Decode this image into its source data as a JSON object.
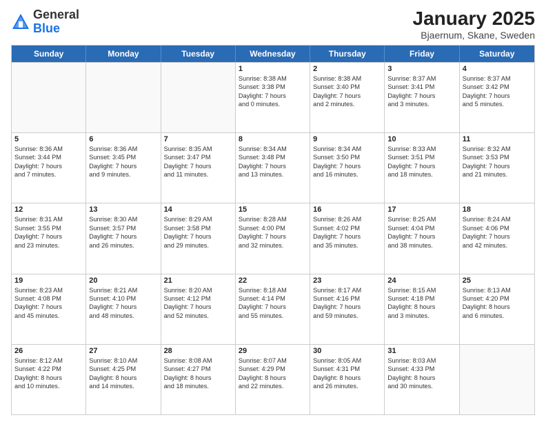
{
  "logo": {
    "general": "General",
    "blue": "Blue"
  },
  "header": {
    "title": "January 2025",
    "subtitle": "Bjaernum, Skane, Sweden"
  },
  "days": [
    "Sunday",
    "Monday",
    "Tuesday",
    "Wednesday",
    "Thursday",
    "Friday",
    "Saturday"
  ],
  "weeks": [
    [
      {
        "day": "",
        "lines": []
      },
      {
        "day": "",
        "lines": []
      },
      {
        "day": "",
        "lines": []
      },
      {
        "day": "1",
        "lines": [
          "Sunrise: 8:38 AM",
          "Sunset: 3:38 PM",
          "Daylight: 7 hours",
          "and 0 minutes."
        ]
      },
      {
        "day": "2",
        "lines": [
          "Sunrise: 8:38 AM",
          "Sunset: 3:40 PM",
          "Daylight: 7 hours",
          "and 2 minutes."
        ]
      },
      {
        "day": "3",
        "lines": [
          "Sunrise: 8:37 AM",
          "Sunset: 3:41 PM",
          "Daylight: 7 hours",
          "and 3 minutes."
        ]
      },
      {
        "day": "4",
        "lines": [
          "Sunrise: 8:37 AM",
          "Sunset: 3:42 PM",
          "Daylight: 7 hours",
          "and 5 minutes."
        ]
      }
    ],
    [
      {
        "day": "5",
        "lines": [
          "Sunrise: 8:36 AM",
          "Sunset: 3:44 PM",
          "Daylight: 7 hours",
          "and 7 minutes."
        ]
      },
      {
        "day": "6",
        "lines": [
          "Sunrise: 8:36 AM",
          "Sunset: 3:45 PM",
          "Daylight: 7 hours",
          "and 9 minutes."
        ]
      },
      {
        "day": "7",
        "lines": [
          "Sunrise: 8:35 AM",
          "Sunset: 3:47 PM",
          "Daylight: 7 hours",
          "and 11 minutes."
        ]
      },
      {
        "day": "8",
        "lines": [
          "Sunrise: 8:34 AM",
          "Sunset: 3:48 PM",
          "Daylight: 7 hours",
          "and 13 minutes."
        ]
      },
      {
        "day": "9",
        "lines": [
          "Sunrise: 8:34 AM",
          "Sunset: 3:50 PM",
          "Daylight: 7 hours",
          "and 16 minutes."
        ]
      },
      {
        "day": "10",
        "lines": [
          "Sunrise: 8:33 AM",
          "Sunset: 3:51 PM",
          "Daylight: 7 hours",
          "and 18 minutes."
        ]
      },
      {
        "day": "11",
        "lines": [
          "Sunrise: 8:32 AM",
          "Sunset: 3:53 PM",
          "Daylight: 7 hours",
          "and 21 minutes."
        ]
      }
    ],
    [
      {
        "day": "12",
        "lines": [
          "Sunrise: 8:31 AM",
          "Sunset: 3:55 PM",
          "Daylight: 7 hours",
          "and 23 minutes."
        ]
      },
      {
        "day": "13",
        "lines": [
          "Sunrise: 8:30 AM",
          "Sunset: 3:57 PM",
          "Daylight: 7 hours",
          "and 26 minutes."
        ]
      },
      {
        "day": "14",
        "lines": [
          "Sunrise: 8:29 AM",
          "Sunset: 3:58 PM",
          "Daylight: 7 hours",
          "and 29 minutes."
        ]
      },
      {
        "day": "15",
        "lines": [
          "Sunrise: 8:28 AM",
          "Sunset: 4:00 PM",
          "Daylight: 7 hours",
          "and 32 minutes."
        ]
      },
      {
        "day": "16",
        "lines": [
          "Sunrise: 8:26 AM",
          "Sunset: 4:02 PM",
          "Daylight: 7 hours",
          "and 35 minutes."
        ]
      },
      {
        "day": "17",
        "lines": [
          "Sunrise: 8:25 AM",
          "Sunset: 4:04 PM",
          "Daylight: 7 hours",
          "and 38 minutes."
        ]
      },
      {
        "day": "18",
        "lines": [
          "Sunrise: 8:24 AM",
          "Sunset: 4:06 PM",
          "Daylight: 7 hours",
          "and 42 minutes."
        ]
      }
    ],
    [
      {
        "day": "19",
        "lines": [
          "Sunrise: 8:23 AM",
          "Sunset: 4:08 PM",
          "Daylight: 7 hours",
          "and 45 minutes."
        ]
      },
      {
        "day": "20",
        "lines": [
          "Sunrise: 8:21 AM",
          "Sunset: 4:10 PM",
          "Daylight: 7 hours",
          "and 48 minutes."
        ]
      },
      {
        "day": "21",
        "lines": [
          "Sunrise: 8:20 AM",
          "Sunset: 4:12 PM",
          "Daylight: 7 hours",
          "and 52 minutes."
        ]
      },
      {
        "day": "22",
        "lines": [
          "Sunrise: 8:18 AM",
          "Sunset: 4:14 PM",
          "Daylight: 7 hours",
          "and 55 minutes."
        ]
      },
      {
        "day": "23",
        "lines": [
          "Sunrise: 8:17 AM",
          "Sunset: 4:16 PM",
          "Daylight: 7 hours",
          "and 59 minutes."
        ]
      },
      {
        "day": "24",
        "lines": [
          "Sunrise: 8:15 AM",
          "Sunset: 4:18 PM",
          "Daylight: 8 hours",
          "and 3 minutes."
        ]
      },
      {
        "day": "25",
        "lines": [
          "Sunrise: 8:13 AM",
          "Sunset: 4:20 PM",
          "Daylight: 8 hours",
          "and 6 minutes."
        ]
      }
    ],
    [
      {
        "day": "26",
        "lines": [
          "Sunrise: 8:12 AM",
          "Sunset: 4:22 PM",
          "Daylight: 8 hours",
          "and 10 minutes."
        ]
      },
      {
        "day": "27",
        "lines": [
          "Sunrise: 8:10 AM",
          "Sunset: 4:25 PM",
          "Daylight: 8 hours",
          "and 14 minutes."
        ]
      },
      {
        "day": "28",
        "lines": [
          "Sunrise: 8:08 AM",
          "Sunset: 4:27 PM",
          "Daylight: 8 hours",
          "and 18 minutes."
        ]
      },
      {
        "day": "29",
        "lines": [
          "Sunrise: 8:07 AM",
          "Sunset: 4:29 PM",
          "Daylight: 8 hours",
          "and 22 minutes."
        ]
      },
      {
        "day": "30",
        "lines": [
          "Sunrise: 8:05 AM",
          "Sunset: 4:31 PM",
          "Daylight: 8 hours",
          "and 26 minutes."
        ]
      },
      {
        "day": "31",
        "lines": [
          "Sunrise: 8:03 AM",
          "Sunset: 4:33 PM",
          "Daylight: 8 hours",
          "and 30 minutes."
        ]
      },
      {
        "day": "",
        "lines": []
      }
    ]
  ]
}
